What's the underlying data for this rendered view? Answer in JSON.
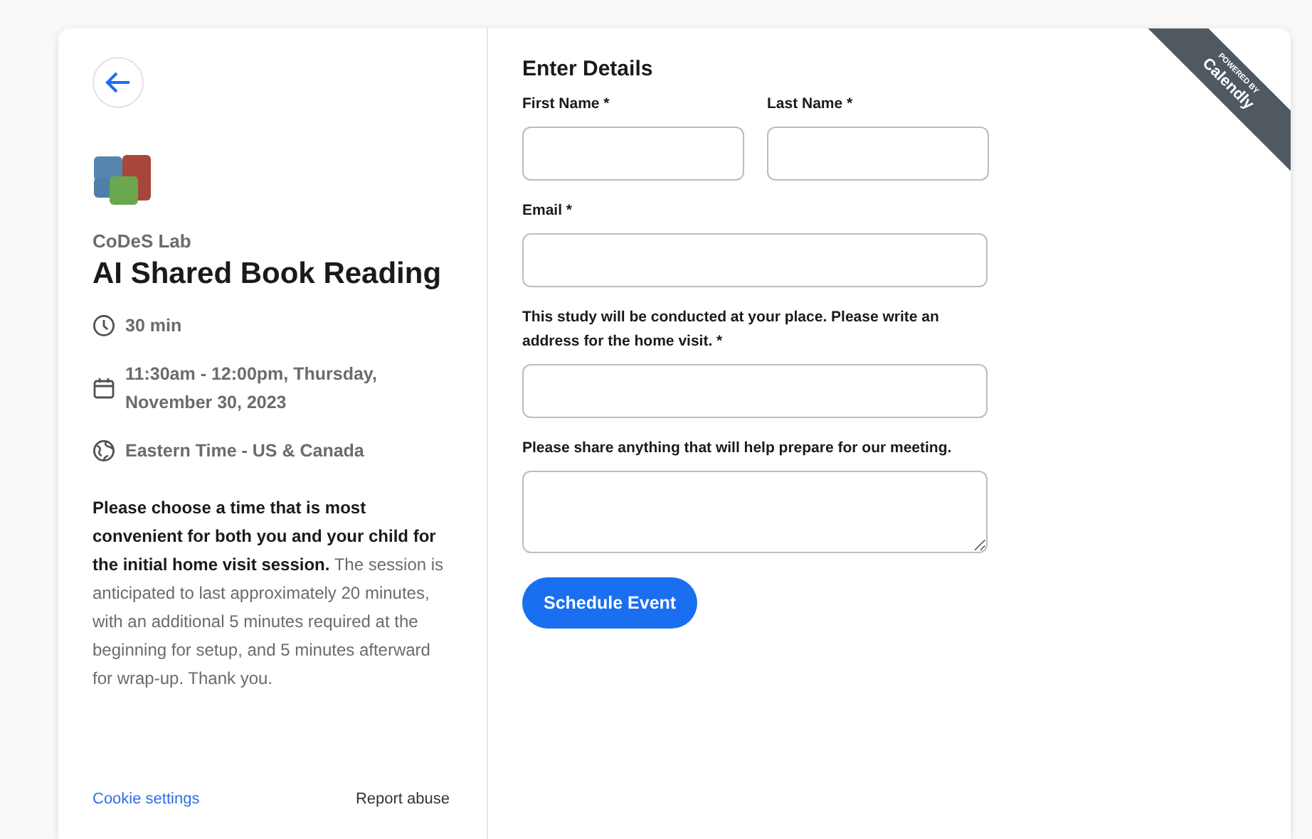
{
  "event": {
    "organizer": "CoDeS Lab",
    "title": "AI Shared Book Reading",
    "details": [
      {
        "kind": "duration",
        "text": "30 min"
      },
      {
        "kind": "date",
        "text": "11:30am - 12:00pm, Thursday, November 30, 2023"
      },
      {
        "kind": "timezone",
        "text": "Eastern Time - US & Canada"
      }
    ],
    "description": "**Please choose a time that is most convenient for both you and your child for the initial home visit session.** The session is anticipated to last approximately 20 minutes, with an additional 5 minutes required at the beginning for setup, and 5 minutes afterward for wrap-up. Thank you."
  },
  "footer": {
    "cookie_link": "Cookie settings",
    "report_link": "Report abuse"
  },
  "form": {
    "heading": "Enter Details",
    "rows": [
      [
        {
          "kind": "input",
          "label": "First Name *"
        },
        {
          "kind": "input",
          "label": "Last Name *"
        }
      ],
      [
        {
          "kind": "input",
          "label": "Email *"
        }
      ],
      [
        {
          "kind": "input",
          "label": "This study will be conducted at your place. Please write an address for the home visit. *"
        }
      ],
      [
        {
          "kind": "textarea",
          "label": "Please share anything that will help prepare for our meeting."
        }
      ]
    ],
    "submit": "Schedule Event"
  },
  "ribbon": {
    "top": "POWERED BY",
    "bottom": "Calendly"
  }
}
